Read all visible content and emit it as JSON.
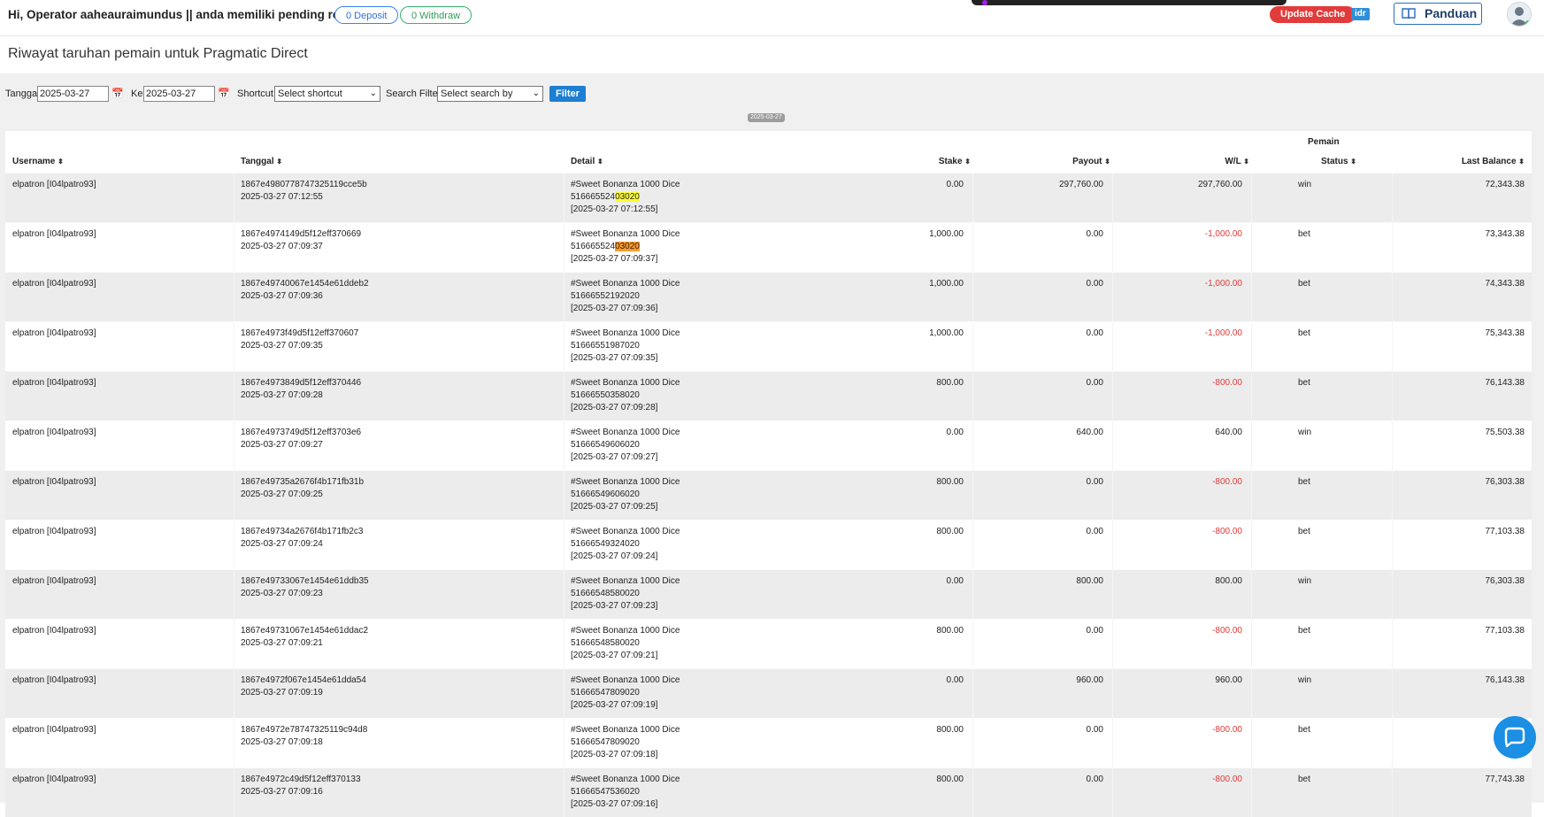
{
  "header": {
    "greeting": "Hi, Operator aaheauraimundus || anda memiliki pending request:",
    "deposit_pill": "0 Deposit",
    "withdraw_pill": "0 Withdraw",
    "update_cache": "Update Cache",
    "currency_badge": "idr",
    "panduan": "Panduan"
  },
  "page_title": "Riwayat taruhan pemain untuk Pragmatic Direct",
  "filters": {
    "tanggal_label": "Tanggal",
    "from_date": "2025-03-27",
    "to_label": "Ke",
    "to_date": "2025-03-27",
    "shortcut_label": "Shortcut:",
    "shortcut_value": "Select shortcut",
    "search_label": "Search Filter:",
    "search_value": "Select search by",
    "filter_button": "Filter"
  },
  "date_chip": "2025-03-27",
  "table": {
    "group_header": "Pemain",
    "columns": [
      "Username",
      "Tanggal",
      "Detail",
      "Stake",
      "Payout",
      "W/L",
      "Status",
      "Last Balance"
    ],
    "rows": [
      {
        "user": "elpatron [I04lpatro93]",
        "id": "1867e4980778747325119cce5b",
        "time": "2025-03-27 07:12:55",
        "game": "#Sweet Bonanza 1000 Dice",
        "round_a": "516665524",
        "round_b": "03020",
        "dtime": "[2025-03-27 07:12:55]",
        "stake": "0.00",
        "payout": "297,760.00",
        "wl": "297,760.00",
        "status": "win",
        "balance": "72,343.38"
      },
      {
        "user": "elpatron [I04lpatro93]",
        "id": "1867e4974149d5f12eff370669",
        "time": "2025-03-27 07:09:37",
        "game": "#Sweet Bonanza 1000 Dice",
        "round_a": "516665524",
        "round_b": "03020",
        "dtime": "[2025-03-27 07:09:37]",
        "stake": "1,000.00",
        "payout": "0.00",
        "wl": "-1,000.00",
        "status": "bet",
        "balance": "73,343.38"
      },
      {
        "user": "elpatron [I04lpatro93]",
        "id": "1867e49740067e1454e61ddeb2",
        "time": "2025-03-27 07:09:36",
        "game": "#Sweet Bonanza 1000 Dice",
        "round_a": "51666552192020",
        "round_b": "",
        "dtime": "[2025-03-27 07:09:36]",
        "stake": "1,000.00",
        "payout": "0.00",
        "wl": "-1,000.00",
        "status": "bet",
        "balance": "74,343.38"
      },
      {
        "user": "elpatron [I04lpatro93]",
        "id": "1867e4973f49d5f12eff370607",
        "time": "2025-03-27 07:09:35",
        "game": "#Sweet Bonanza 1000 Dice",
        "round_a": "51666551987020",
        "round_b": "",
        "dtime": "[2025-03-27 07:09:35]",
        "stake": "1,000.00",
        "payout": "0.00",
        "wl": "-1,000.00",
        "status": "bet",
        "balance": "75,343.38"
      },
      {
        "user": "elpatron [I04lpatro93]",
        "id": "1867e4973849d5f12eff370446",
        "time": "2025-03-27 07:09:28",
        "game": "#Sweet Bonanza 1000 Dice",
        "round_a": "51666550358020",
        "round_b": "",
        "dtime": "[2025-03-27 07:09:28]",
        "stake": "800.00",
        "payout": "0.00",
        "wl": "-800.00",
        "status": "bet",
        "balance": "76,143.38"
      },
      {
        "user": "elpatron [I04lpatro93]",
        "id": "1867e4973749d5f12eff3703e6",
        "time": "2025-03-27 07:09:27",
        "game": "#Sweet Bonanza 1000 Dice",
        "round_a": "51666549606020",
        "round_b": "",
        "dtime": "[2025-03-27 07:09:27]",
        "stake": "0.00",
        "payout": "640.00",
        "wl": "640.00",
        "status": "win",
        "balance": "75,503.38"
      },
      {
        "user": "elpatron [I04lpatro93]",
        "id": "1867e49735a2676f4b171fb31b",
        "time": "2025-03-27 07:09:25",
        "game": "#Sweet Bonanza 1000 Dice",
        "round_a": "51666549606020",
        "round_b": "",
        "dtime": "[2025-03-27 07:09:25]",
        "stake": "800.00",
        "payout": "0.00",
        "wl": "-800.00",
        "status": "bet",
        "balance": "76,303.38"
      },
      {
        "user": "elpatron [I04lpatro93]",
        "id": "1867e49734a2676f4b171fb2c3",
        "time": "2025-03-27 07:09:24",
        "game": "#Sweet Bonanza 1000 Dice",
        "round_a": "51666549324020",
        "round_b": "",
        "dtime": "[2025-03-27 07:09:24]",
        "stake": "800.00",
        "payout": "0.00",
        "wl": "-800.00",
        "status": "bet",
        "balance": "77,103.38"
      },
      {
        "user": "elpatron [I04lpatro93]",
        "id": "1867e49733067e1454e61ddb35",
        "time": "2025-03-27 07:09:23",
        "game": "#Sweet Bonanza 1000 Dice",
        "round_a": "51666548580020",
        "round_b": "",
        "dtime": "[2025-03-27 07:09:23]",
        "stake": "0.00",
        "payout": "800.00",
        "wl": "800.00",
        "status": "win",
        "balance": "76,303.38"
      },
      {
        "user": "elpatron [I04lpatro93]",
        "id": "1867e49731067e1454e61ddac2",
        "time": "2025-03-27 07:09:21",
        "game": "#Sweet Bonanza 1000 Dice",
        "round_a": "51666548580020",
        "round_b": "",
        "dtime": "[2025-03-27 07:09:21]",
        "stake": "800.00",
        "payout": "0.00",
        "wl": "-800.00",
        "status": "bet",
        "balance": "77,103.38"
      },
      {
        "user": "elpatron [I04lpatro93]",
        "id": "1867e4972f067e1454e61dda54",
        "time": "2025-03-27 07:09:19",
        "game": "#Sweet Bonanza 1000 Dice",
        "round_a": "51666547809020",
        "round_b": "",
        "dtime": "[2025-03-27 07:09:19]",
        "stake": "0.00",
        "payout": "960.00",
        "wl": "960.00",
        "status": "win",
        "balance": "76,143.38"
      },
      {
        "user": "elpatron [I04lpatro93]",
        "id": "1867e4972e78747325119c94d8",
        "time": "2025-03-27 07:09:18",
        "game": "#Sweet Bonanza 1000 Dice",
        "round_a": "51666547809020",
        "round_b": "",
        "dtime": "[2025-03-27 07:09:18]",
        "stake": "800.00",
        "payout": "0.00",
        "wl": "-800.00",
        "status": "bet",
        "balance": "76,9"
      },
      {
        "user": "elpatron [I04lpatro93]",
        "id": "1867e4972c49d5f12eff370133",
        "time": "2025-03-27 07:09:16",
        "game": "#Sweet Bonanza 1000 Dice",
        "round_a": "51666547536020",
        "round_b": "",
        "dtime": "[2025-03-27 07:09:16]",
        "stake": "800.00",
        "payout": "0.00",
        "wl": "-800.00",
        "status": "bet",
        "balance": "77,743.38"
      }
    ]
  },
  "colors": {
    "negative": "#e03a3a",
    "accent": "#1d7fd1",
    "cache_red": "#e23b3b",
    "hl_yellow": "#ffff33",
    "hl_orange": "#ff9a2a"
  },
  "icons": [
    "calendar-icon",
    "sort-icon",
    "book-icon",
    "user-avatar-icon",
    "chat-icon"
  ]
}
